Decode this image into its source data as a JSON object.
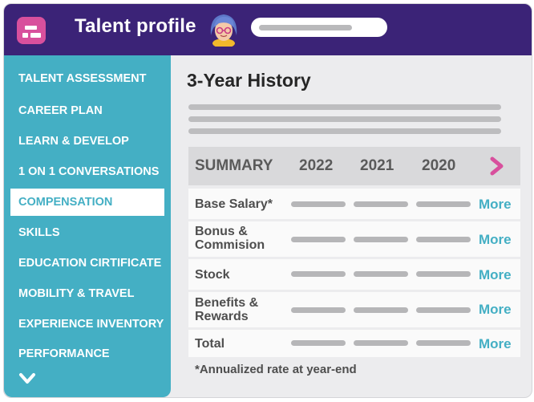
{
  "header": {
    "title": "Talent profile",
    "logo_icon": "app-logo-icon",
    "avatar_icon": "user-avatar-icon",
    "search_placeholder_bar": "search-placeholder"
  },
  "sidebar": {
    "items": [
      {
        "label": "TALENT ASSESSMENT"
      },
      {
        "label": "CAREER PLAN"
      },
      {
        "label": "LEARN & DEVELOP"
      },
      {
        "label": "1 ON 1 CONVERSATIONS"
      },
      {
        "label": "COMPENSATION",
        "active": true
      },
      {
        "label": "SKILLS"
      },
      {
        "label": "EDUCATION CIRTIFICATE"
      },
      {
        "label": "MOBILITY & TRAVEL"
      },
      {
        "label": "EXPERIENCE INVENTORY"
      },
      {
        "label": "PERFORMANCE"
      }
    ],
    "expand_icon": "chevron-down-icon"
  },
  "main": {
    "section_title": "3-Year History",
    "summary": {
      "header_label": "SUMMARY",
      "years": [
        "2022",
        "2021",
        "2020"
      ],
      "next_icon": "chevron-right-icon"
    },
    "rows": [
      {
        "label": "Base Salary*",
        "more": "More"
      },
      {
        "label": "Bonus &\nCommision",
        "more": "More"
      },
      {
        "label": "Stock",
        "more": "More"
      },
      {
        "label": "Benefits &\nRewards",
        "more": "More"
      },
      {
        "label": "Total",
        "more": "More"
      }
    ],
    "footnote": "*Annualized rate at year-end"
  },
  "colors": {
    "header_bg": "#3b2377",
    "accent_pink": "#d8509d",
    "sidebar_teal": "#44afc4",
    "link_teal": "#44afc4"
  }
}
